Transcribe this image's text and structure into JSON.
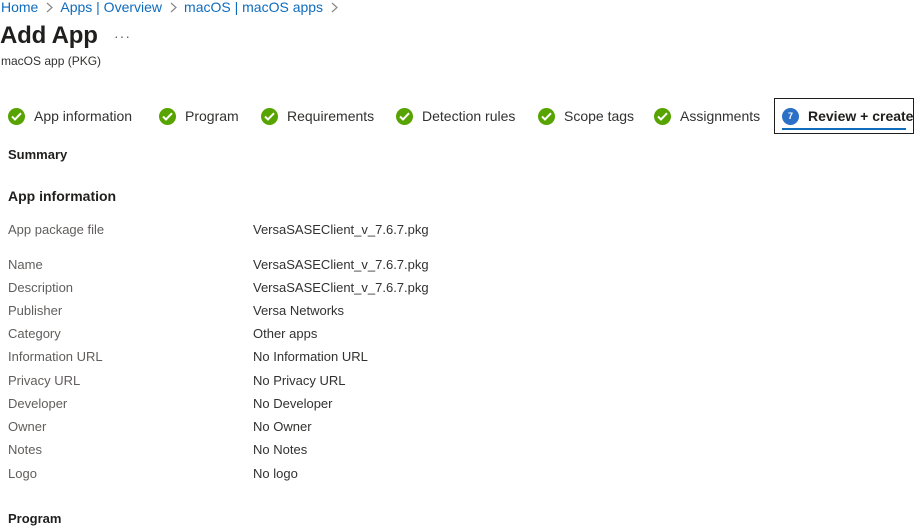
{
  "breadcrumb": {
    "items": [
      "Home",
      "Apps | Overview",
      "macOS | macOS apps"
    ]
  },
  "page": {
    "title": "Add App",
    "more": "···",
    "subtitle": "macOS app (PKG)"
  },
  "steps": [
    {
      "label": "App information",
      "state": "completed"
    },
    {
      "label": "Program",
      "state": "completed"
    },
    {
      "label": "Requirements",
      "state": "completed"
    },
    {
      "label": "Detection rules",
      "state": "completed"
    },
    {
      "label": "Scope tags",
      "state": "completed"
    },
    {
      "label": "Assignments",
      "state": "completed"
    },
    {
      "label": "Review + create",
      "state": "active",
      "number": "7"
    }
  ],
  "summary": {
    "title": "Summary"
  },
  "app_information": {
    "heading": "App information",
    "package_file": {
      "label": "App package file",
      "value": "VersaSASEClient_v_7.6.7.pkg"
    },
    "fields": [
      {
        "label": "Name",
        "value": "VersaSASEClient_v_7.6.7.pkg"
      },
      {
        "label": "Description",
        "value": "VersaSASEClient_v_7.6.7.pkg"
      },
      {
        "label": "Publisher",
        "value": "Versa Networks"
      },
      {
        "label": "Category",
        "value": "Other apps"
      },
      {
        "label": "Information URL",
        "value": "No Information URL"
      },
      {
        "label": "Privacy URL",
        "value": "No Privacy URL"
      },
      {
        "label": "Developer",
        "value": "No Developer"
      },
      {
        "label": "Owner",
        "value": "No Owner"
      },
      {
        "label": "Notes",
        "value": "No Notes"
      },
      {
        "label": "Logo",
        "value": "No logo"
      }
    ]
  },
  "program": {
    "heading": "Program"
  },
  "colors": {
    "link": "#0f6cbd",
    "check": "#57a300",
    "active_step": "#2b6fc7"
  }
}
